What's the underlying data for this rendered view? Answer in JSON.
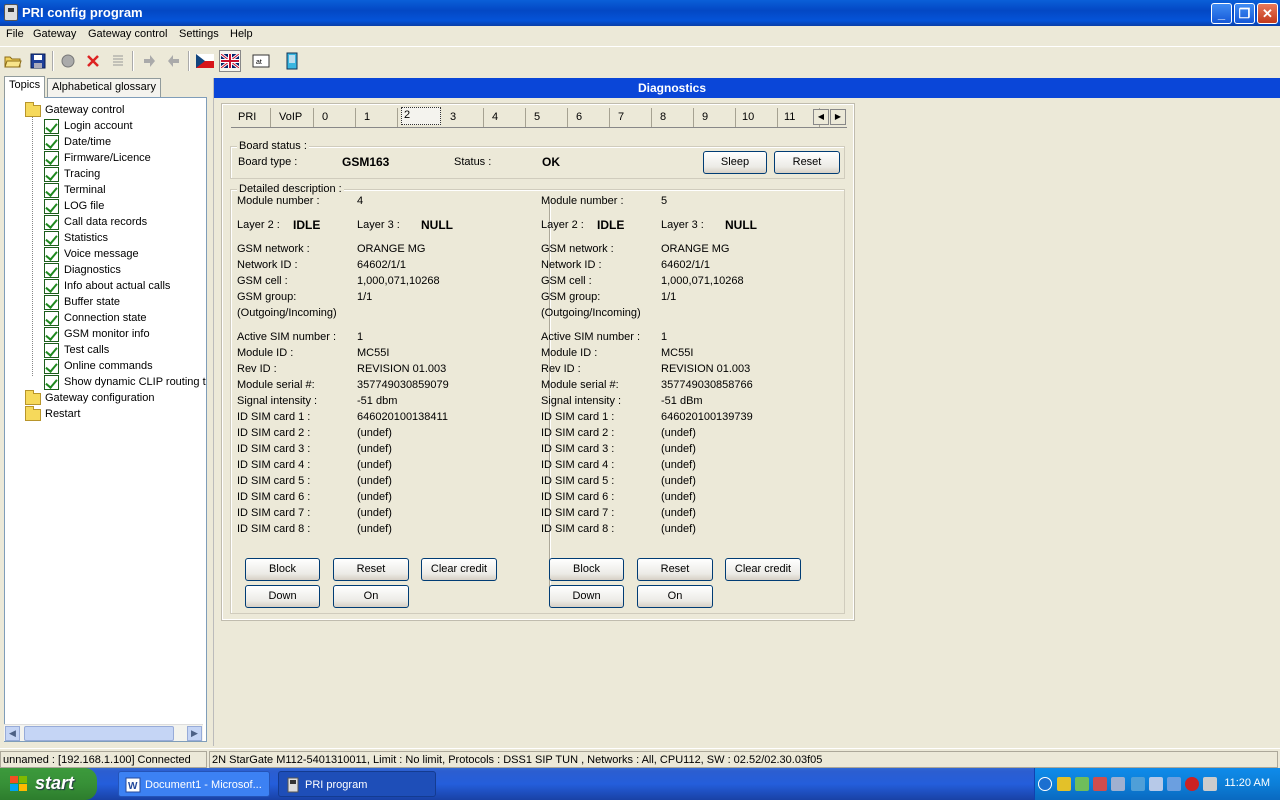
{
  "window": {
    "title": "PRI config program"
  },
  "menu": [
    "File",
    "Gateway",
    "Gateway control",
    "Settings",
    "Help"
  ],
  "left": {
    "tabs": [
      "Topics",
      "Alphabetical glossary"
    ],
    "tree": {
      "root": "Gateway control",
      "children": [
        "Login account",
        "Date/time",
        "Firmware/Licence",
        "Tracing",
        "Terminal",
        "LOG file",
        "Call data records",
        "Statistics",
        "Voice message",
        "Diagnostics",
        "Info about actual calls",
        "Buffer state",
        "Connection state",
        "GSM monitor info",
        "Test calls",
        "Online commands",
        "Show dynamic CLIP routing t"
      ],
      "other": [
        "Gateway configuration",
        "Restart"
      ]
    }
  },
  "diag": {
    "header": "Diagnostics",
    "tabs": [
      "PRI",
      "VoIP",
      "0",
      "1",
      "2",
      "3",
      "4",
      "5",
      "6",
      "7",
      "8",
      "9",
      "10",
      "11"
    ],
    "selected_tab": "2",
    "board": {
      "group_title": "Board status :",
      "type_label": "Board type :",
      "type_value": "GSM163",
      "status_label": "Status :",
      "status_value": "OK",
      "sleep": "Sleep",
      "reset": "Reset"
    },
    "detail_title": "Detailed description :",
    "labels": {
      "module_number": "Module number :",
      "layer2": "Layer 2 :",
      "layer3": "Layer 3 :",
      "gsm_network": "GSM network :",
      "network_id": "Network ID :",
      "gsm_cell": "GSM cell :",
      "gsm_group": "GSM group:",
      "direction": "(Outgoing/Incoming)",
      "active_sim": "Active SIM number :",
      "module_id": "Module ID :",
      "rev_id": "Rev ID :",
      "serial": "Module serial #:",
      "signal": "Signal intensity :",
      "sim1": "ID SIM card 1 :",
      "sim2": "ID SIM card 2 :",
      "sim3": "ID SIM card 3 :",
      "sim4": "ID SIM card 4 :",
      "sim5": "ID SIM card 5 :",
      "sim6": "ID SIM card 6 :",
      "sim7": "ID SIM card 7 :",
      "sim8": "ID SIM card 8 :"
    },
    "modules": [
      {
        "module_number": "4",
        "layer2": "IDLE",
        "layer3": "NULL",
        "gsm_network": "ORANGE MG",
        "network_id": "64602/1/1",
        "gsm_cell": "1,000,071,10268",
        "gsm_group": "1/1",
        "active_sim": "1",
        "module_id": "MC55I",
        "rev_id": "REVISION 01.003",
        "serial": "357749030859079",
        "signal": "-51 dbm",
        "sim1": "646020100138411",
        "sim2": "(undef)",
        "sim3": "(undef)",
        "sim4": "(undef)",
        "sim5": "(undef)",
        "sim6": "(undef)",
        "sim7": "(undef)",
        "sim8": "(undef)",
        "buttons": {
          "block": "Block",
          "reset": "Reset",
          "clear": "Clear credit",
          "down": "Down",
          "on": "On"
        }
      },
      {
        "module_number": "5",
        "layer2": "IDLE",
        "layer3": "NULL",
        "gsm_network": "ORANGE MG",
        "network_id": "64602/1/1",
        "gsm_cell": "1,000,071,10268",
        "gsm_group": "1/1",
        "active_sim": "1",
        "module_id": "MC55I",
        "rev_id": "REVISION 01.003",
        "serial": "357749030858766",
        "signal": "-51 dBm",
        "sim1": "646020100139739",
        "sim2": "(undef)",
        "sim3": "(undef)",
        "sim4": "(undef)",
        "sim5": "(undef)",
        "sim6": "(undef)",
        "sim7": "(undef)",
        "sim8": "(undef)",
        "buttons": {
          "block": "Block",
          "reset": "Reset",
          "clear": "Clear credit",
          "down": "Down",
          "on": "On"
        }
      }
    ]
  },
  "status": {
    "left": "unnamed : [192.168.1.100] Connected",
    "right": "2N StarGate M112-5401310011, Limit : No limit, Protocols : DSS1 SIP TUN , Networks : All, CPU112, SW : 02.52/02.30.03f05"
  },
  "taskbar": {
    "start": "start",
    "items": [
      "Document1 - Microsof...",
      "PRI program"
    ],
    "clock": "11:20 AM"
  }
}
